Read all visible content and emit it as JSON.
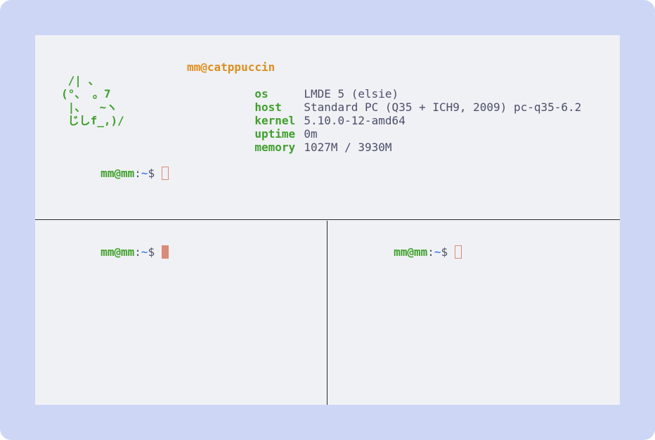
{
  "fetch": {
    "ascii_art": [
      " /| 、",
      "(°、 。7",
      " |、  ~ヽ",
      " じしf_,)/"
    ],
    "user_host": "mm@catppuccin",
    "rows": [
      {
        "key": "os",
        "value": "LMDE 5 (elsie)"
      },
      {
        "key": "host",
        "value": "Standard PC (Q35 + ICH9, 2009) pc-q35-6.2"
      },
      {
        "key": "kernel",
        "value": "5.10.0-12-amd64"
      },
      {
        "key": "uptime",
        "value": "0m"
      },
      {
        "key": "memory",
        "value": "1027M / 3930M"
      }
    ]
  },
  "prompt": {
    "user_host": "mm@mm",
    "separator": ":",
    "path": "~",
    "symbol": "$"
  },
  "colors": {
    "frame": "#ced6f5",
    "terminal_bg": "#eff1f5",
    "green": "#40a02b",
    "orange": "#df8e1d",
    "blue": "#1e66f5",
    "text": "#4c4f69",
    "cursor": "#dc8a78",
    "divider": "#2b2b2b"
  },
  "panes": [
    {
      "name": "top",
      "cursor": "hollow"
    },
    {
      "name": "bottom-left",
      "cursor": "solid"
    },
    {
      "name": "bottom-right",
      "cursor": "hollow"
    }
  ]
}
